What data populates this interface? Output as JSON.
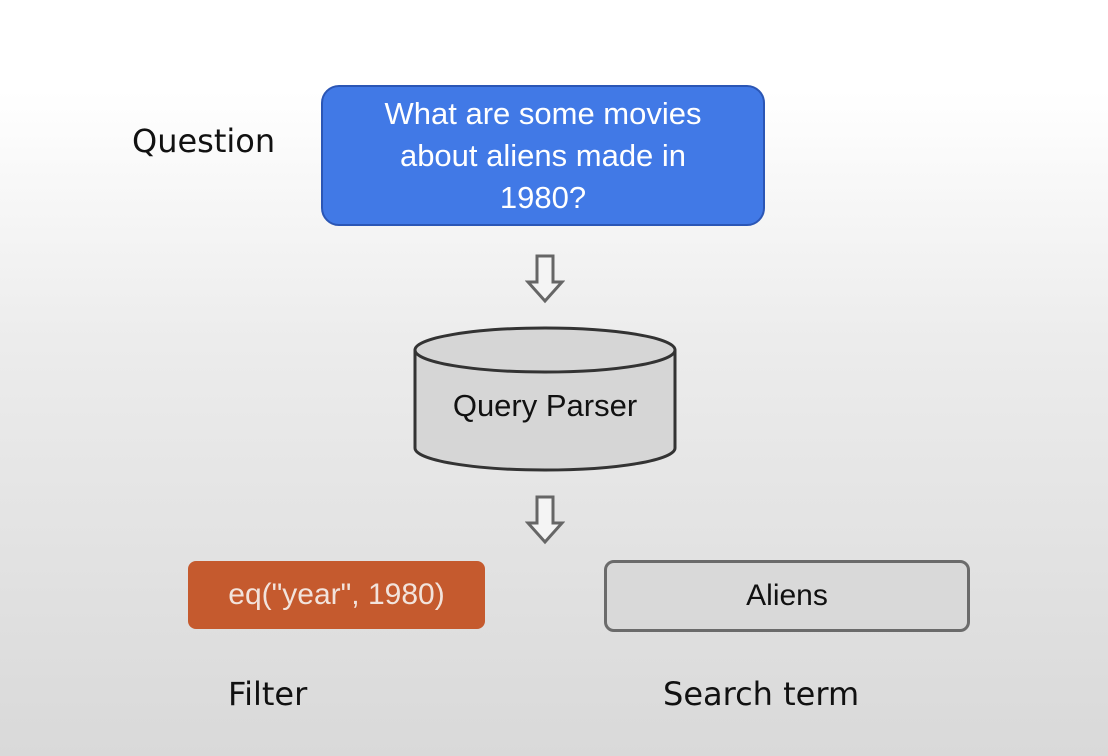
{
  "question": {
    "label": "Question",
    "text": "What are some movies about aliens made in 1980?"
  },
  "parser": {
    "label": "Query Parser"
  },
  "filter": {
    "expression": "eq(\"year\", 1980)",
    "label": "Filter"
  },
  "search_term": {
    "value": "Aliens",
    "label": "Search term"
  },
  "colors": {
    "question_box": "#4179e6",
    "filter_box": "#c55a2e",
    "search_box": "#d9d9d9",
    "parser_fill": "#d6d6d6"
  },
  "icons": [
    "down-arrow-icon",
    "database-cylinder-icon"
  ]
}
